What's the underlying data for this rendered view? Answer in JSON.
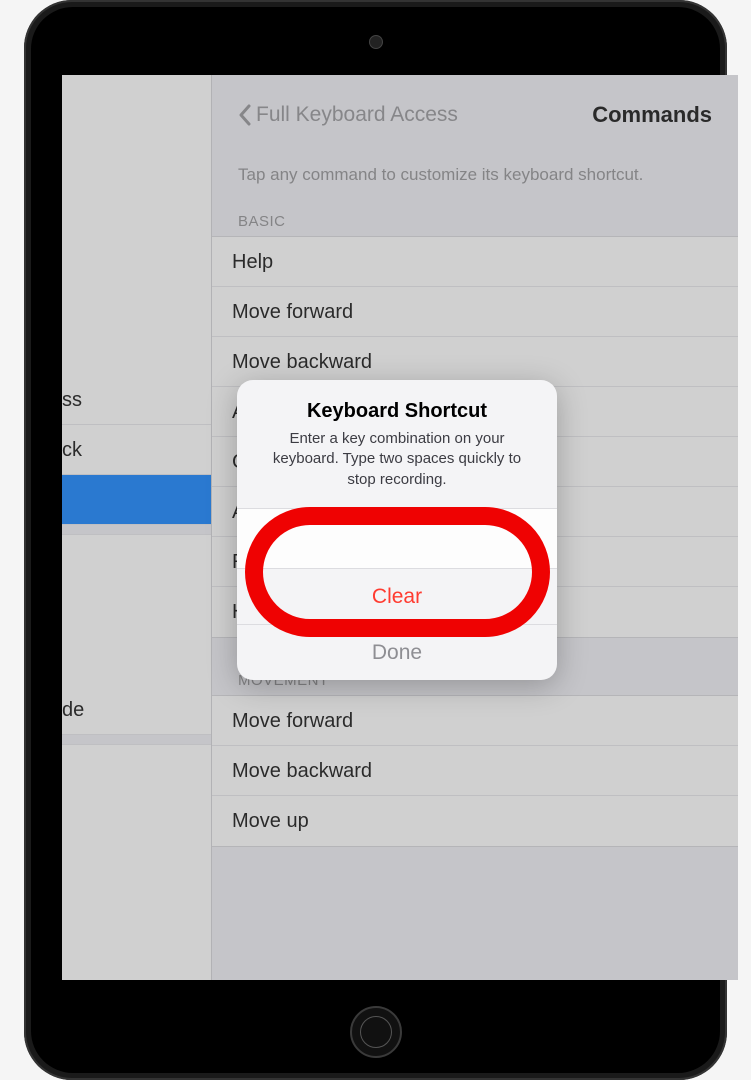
{
  "nav": {
    "back_label": "Full Keyboard Access",
    "title": "Commands"
  },
  "hint": "Tap any command to customize its keyboard shortcut.",
  "sections": {
    "basic": {
      "header": "BASIC",
      "items": [
        "Help",
        "Move forward",
        "Move backward",
        "Activate",
        "Go to Home Screen",
        "Activate Accessibility Shortcut",
        "Restart",
        "Home"
      ]
    },
    "movement": {
      "header": "MOVEMENT",
      "items": [
        "Move forward",
        "Move backward",
        "Move up"
      ]
    }
  },
  "master_rows": {
    "r1": "ss",
    "r2": "ck",
    "r3": "",
    "r4": "de"
  },
  "alert": {
    "title": "Keyboard Shortcut",
    "message": "Enter a key combination on your keyboard. Type two spaces quickly to stop recording.",
    "clear": "Clear",
    "done": "Done"
  }
}
